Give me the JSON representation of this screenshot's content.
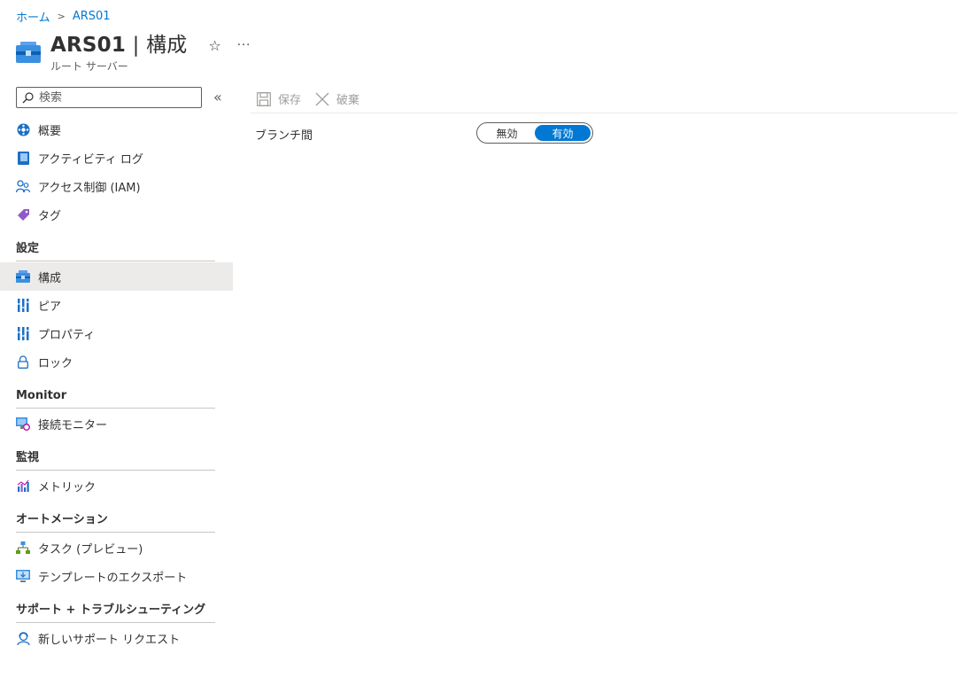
{
  "breadcrumb": {
    "home": "ホーム",
    "current": "ARS01"
  },
  "header": {
    "title_main": "ARS01",
    "title_sep": " | ",
    "title_page": "構成",
    "subtitle": "ルート サーバー",
    "favorite_icon": "star-icon",
    "more": "···"
  },
  "search": {
    "placeholder": "検索"
  },
  "nav": {
    "top": [
      {
        "label": "概要",
        "icon": "overview-icon"
      },
      {
        "label": "アクティビティ ログ",
        "icon": "activity-log-icon"
      },
      {
        "label": "アクセス制御 (IAM)",
        "icon": "iam-icon"
      },
      {
        "label": "タグ",
        "icon": "tag-icon"
      }
    ],
    "settings": {
      "title": "設定",
      "items": [
        {
          "label": "構成",
          "icon": "configuration-icon",
          "active": true
        },
        {
          "label": "ピア",
          "icon": "peers-icon"
        },
        {
          "label": "プロパティ",
          "icon": "properties-icon"
        },
        {
          "label": "ロック",
          "icon": "lock-icon"
        }
      ]
    },
    "monitor": {
      "title": "Monitor",
      "items": [
        {
          "label": "接続モニター",
          "icon": "connection-monitor-icon"
        }
      ]
    },
    "monitoring": {
      "title": "監視",
      "items": [
        {
          "label": "メトリック",
          "icon": "metrics-icon"
        }
      ]
    },
    "automation": {
      "title": "オートメーション",
      "items": [
        {
          "label": "タスク (プレビュー)",
          "icon": "tasks-icon"
        },
        {
          "label": "テンプレートのエクスポート",
          "icon": "export-template-icon"
        }
      ]
    },
    "support": {
      "title": "サポート + トラブルシューティング",
      "items": [
        {
          "label": "新しいサポート リクエスト",
          "icon": "support-request-icon"
        }
      ]
    }
  },
  "toolbar": {
    "save": "保存",
    "discard": "破棄"
  },
  "config": {
    "branch_label": "ブランチ間",
    "toggle_off": "無効",
    "toggle_on": "有効",
    "selected": "有効"
  },
  "colors": {
    "accent": "#0078d4",
    "active_bg": "#edebe9"
  }
}
